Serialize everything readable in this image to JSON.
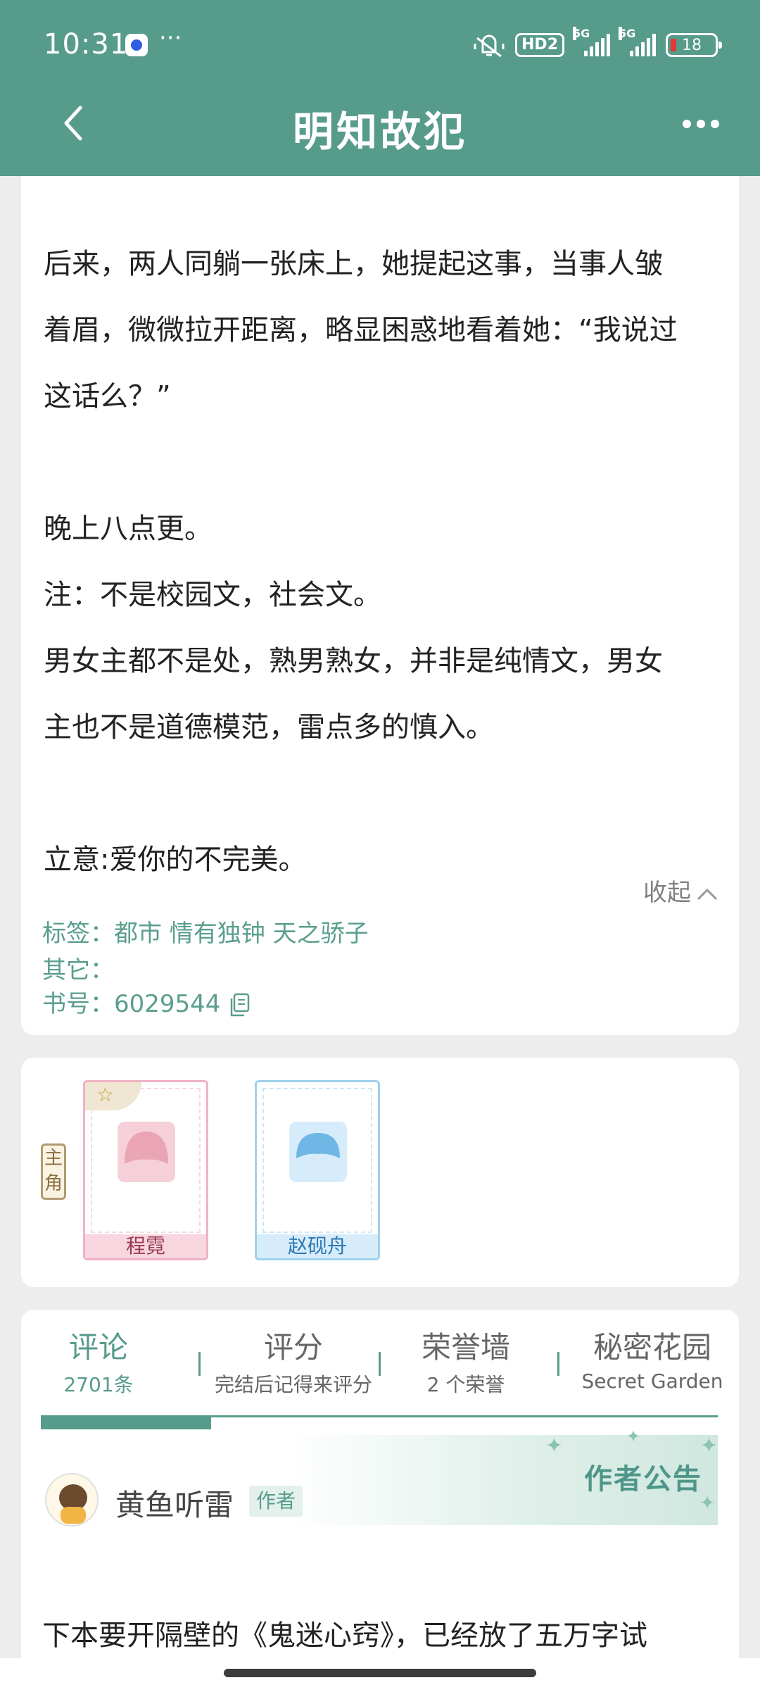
{
  "status_bar": {
    "time": "10:31",
    "dots": "···",
    "hd_label": "HD2",
    "net1": "5G",
    "net2": "5G",
    "battery": "18"
  },
  "header": {
    "title": "明知故犯"
  },
  "synopsis": {
    "lines": [
      "后来，两人同躺一张床上，她提起这事，当事人皱",
      "着眉，微微拉开距离，略显困惑地看着她：“我说过",
      "这话么？”",
      "晚上八点更。",
      "注：不是校园文，社会文。",
      "男女主都不是处，熟男熟女，并非是纯情文，男女",
      "主也不是道德模范，雷点多的慎入。",
      "立意:爱你的不完美。"
    ],
    "collapse_label": "收起",
    "tags_label": "标签：都市 情有独钟 天之骄子",
    "other_label": "其它：",
    "book_id_label": "书号：6029544"
  },
  "roles": {
    "tag": "主角",
    "characters": [
      {
        "name": "程霓"
      },
      {
        "name": "赵砚舟"
      }
    ]
  },
  "tabs": [
    {
      "title": "评论",
      "sub": "2701条"
    },
    {
      "title": "评分",
      "sub": "完结后记得来评分"
    },
    {
      "title": "荣誉墙",
      "sub": "2 个荣誉"
    },
    {
      "title": "秘密花园",
      "sub": "Secret Garden"
    }
  ],
  "notice": {
    "banner": "作者公告",
    "author": "黄鱼听雷",
    "badge": "作者",
    "text": "下本要开隔壁的《鬼迷心窍》，已经放了五万字试"
  },
  "colors": {
    "accent": "#579b8b",
    "pink": "#f0b2c4",
    "blue": "#9ed0ec"
  }
}
